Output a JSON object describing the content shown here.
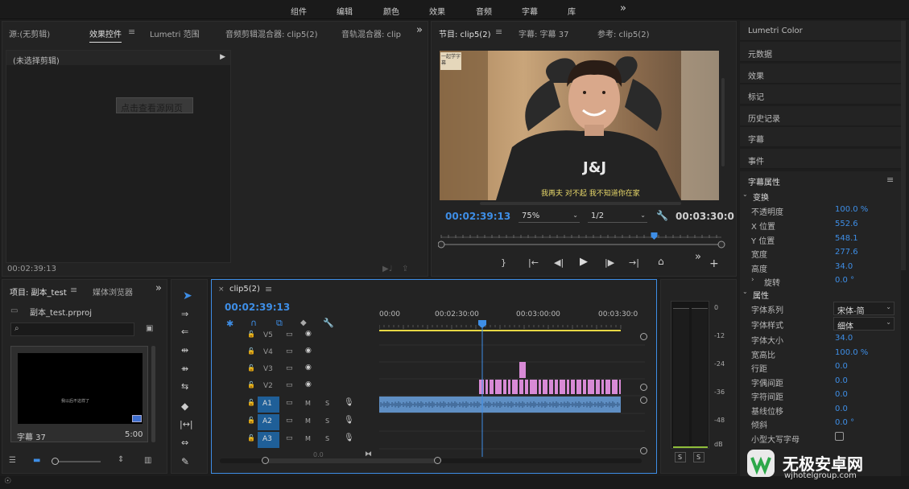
{
  "menu": {
    "items": [
      "组件",
      "编辑",
      "颜色",
      "效果",
      "音频",
      "字幕",
      "库"
    ],
    "more": "»"
  },
  "source_panel": {
    "tabs": [
      "源:(无剪辑)",
      "效果控件",
      "Lumetri 范围",
      "音频剪辑混合器: clip5(2)",
      "音轨混合器: clip"
    ],
    "active_tab": "效果控件",
    "no_clip": "(未选择剪辑)",
    "hint_button": "点击查看源网页",
    "timecode": "00:02:39:13"
  },
  "program_monitor": {
    "tabs": [
      "节目: clip5(2)",
      "字幕: 字幕 37",
      "参考: clip5(2)"
    ],
    "subtitle": "我再夫 对不起 我不知道你在家",
    "shirt_text": "J&J",
    "logo_text": "一起学字幕",
    "timecode": "00:02:39:13",
    "zoom": "75%",
    "resolution": "1/2",
    "duration": "00:03:30:0",
    "playhead_fraction": 0.76
  },
  "right_panel": {
    "items": [
      "Lumetri Color",
      "元数据",
      "效果",
      "标记",
      "历史记录",
      "字幕",
      "事件"
    ],
    "caption_props_title": "字幕属性",
    "transform_section": "变换",
    "transform": [
      {
        "label": "不透明度",
        "value": "100.0 %"
      },
      {
        "label": "X 位置",
        "value": "552.6"
      },
      {
        "label": "Y 位置",
        "value": "548.1"
      },
      {
        "label": "宽度",
        "value": "277.6"
      },
      {
        "label": "高度",
        "value": "34.0"
      },
      {
        "label": "旋转",
        "value": "0.0 °"
      }
    ],
    "attr_section": "属性",
    "font_family_label": "字体系列",
    "font_family": "宋体-简",
    "font_style_label": "字体样式",
    "font_style": "细体",
    "attrs": [
      {
        "label": "字体大小",
        "value": "34.0"
      },
      {
        "label": "宽高比",
        "value": "100.0 %"
      },
      {
        "label": "行距",
        "value": "0.0"
      },
      {
        "label": "字偶间距",
        "value": "0.0"
      },
      {
        "label": "字符间距",
        "value": "0.0"
      },
      {
        "label": "基线位移",
        "value": "0.0"
      },
      {
        "label": "倾斜",
        "value": "0.0 °"
      }
    ],
    "small_caps_label": "小型大写字母"
  },
  "project_panel": {
    "tabs": [
      "项目: 副本_test",
      "媒体浏览器"
    ],
    "file": "副本_test.prproj",
    "thumb_caption": "我以后不这样了",
    "item_name": "字幕 37",
    "item_duration": "5:00"
  },
  "timeline": {
    "tab": "clip5(2)",
    "timecode": "00:02:39:13",
    "ruler": [
      "00:00",
      "00:02:30:00",
      "00:03:00:00",
      "00:03:30:0"
    ],
    "video_tracks": [
      "V5",
      "V4",
      "V3",
      "V2"
    ],
    "audio_tracks": [
      "A1",
      "A2",
      "A3"
    ],
    "audio_m": "M",
    "audio_s": "S",
    "bottom_value": "0.0"
  },
  "meter": {
    "scale": [
      "0",
      "-12",
      "-24",
      "-36",
      "-48",
      "dB"
    ],
    "solo": [
      "S",
      "S"
    ]
  },
  "watermark": {
    "name": "无极安卓网",
    "url": "wjhotelgroup.com"
  },
  "colors": {
    "accent": "#3e8ee6",
    "clip_pink": "#d88ad6",
    "audio_clip": "#6a9acb",
    "track_active": "#1f5f98"
  }
}
